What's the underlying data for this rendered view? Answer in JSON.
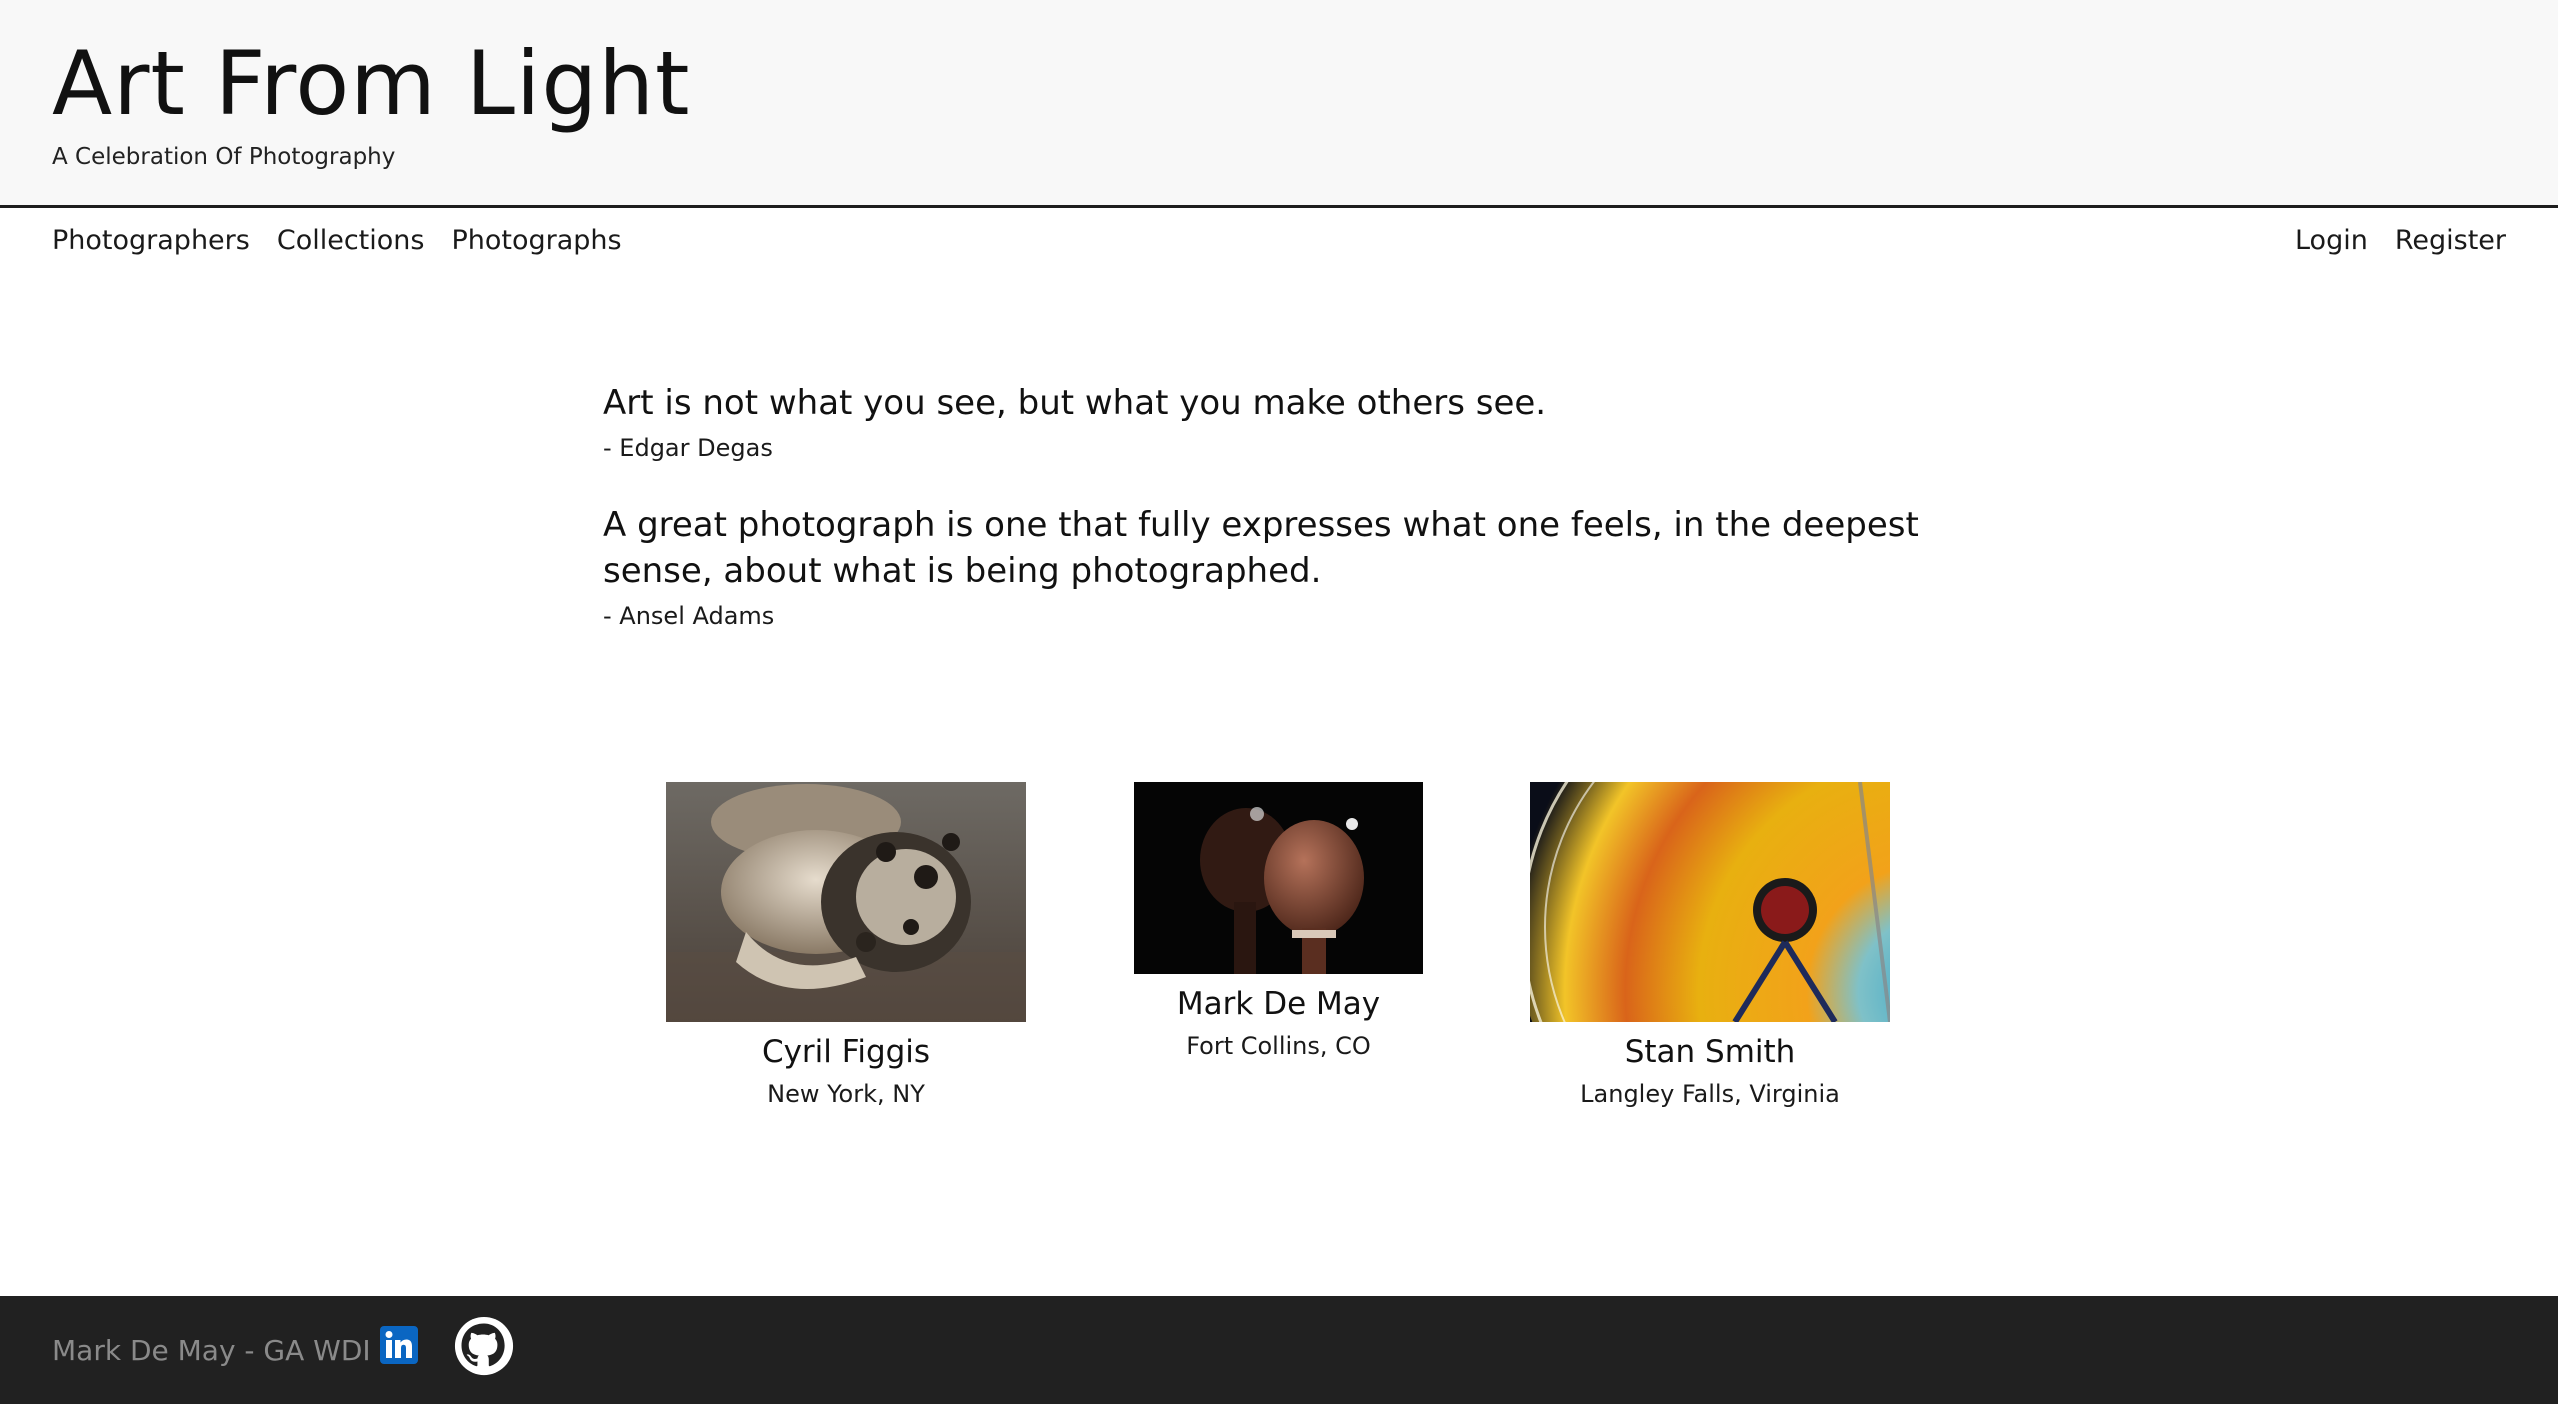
{
  "header": {
    "title": "Art From Light",
    "subtitle": "A Celebration Of Photography"
  },
  "nav": {
    "left": [
      "Photographers",
      "Collections",
      "Photographs"
    ],
    "right": [
      "Login",
      "Register"
    ]
  },
  "quotes": [
    {
      "text": "Art is not what you see, but what you make others see.",
      "author": "- Edgar Degas"
    },
    {
      "text": "A great photograph is one that fully expresses what one feels, in the deepest sense, about what is being photographed.",
      "author": "- Ansel Adams"
    }
  ],
  "photographers": [
    {
      "name": "Cyril Figgis",
      "location": "New York, NY",
      "thumbnail_subject": "mushrooms"
    },
    {
      "name": "Mark De May",
      "location": "Fort Collins, CO",
      "thumbnail_subject": "wooden-chess-pieces"
    },
    {
      "name": "Stan Smith",
      "location": "Langley Falls, Virginia",
      "thumbnail_subject": "ferris-wheel-at-night"
    }
  ],
  "footer": {
    "text": "Mark De May - GA WDI",
    "icons": [
      "linkedin-icon",
      "github-icon"
    ]
  },
  "colors": {
    "header_bg": "#f8f8f8",
    "footer_bg": "#212121",
    "footer_text": "#8a8a8a",
    "linkedin_blue": "#0a66c2"
  }
}
